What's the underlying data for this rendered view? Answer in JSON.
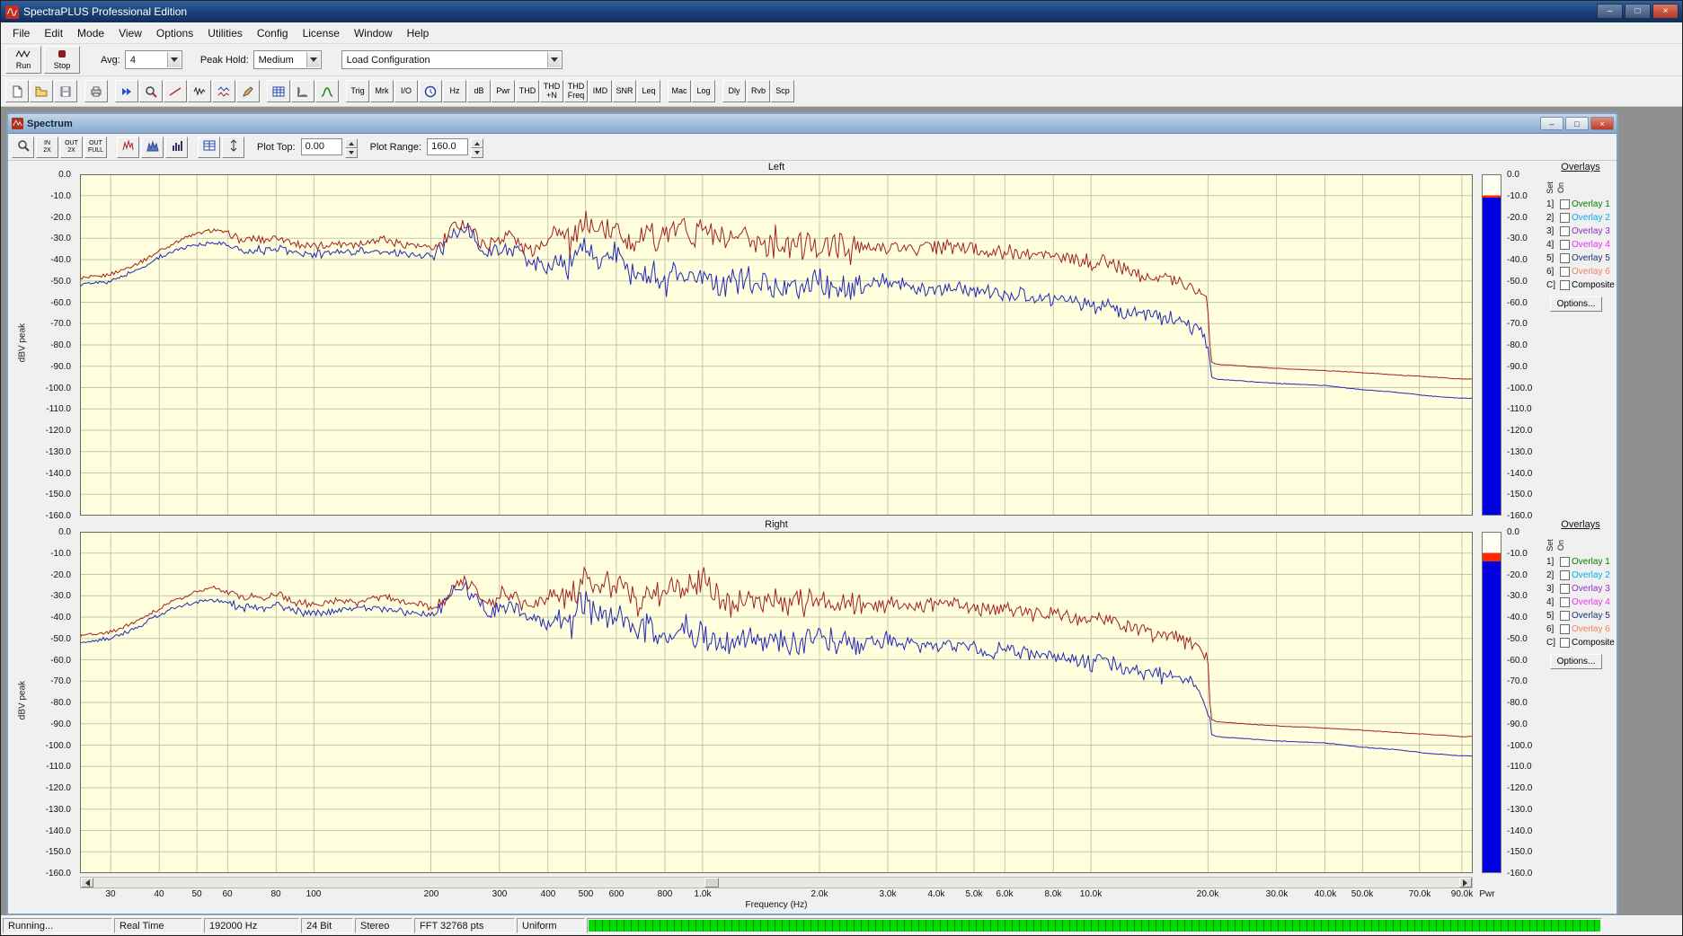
{
  "window": {
    "title": "SpectraPLUS Professional Edition"
  },
  "icons": {
    "minimize": "–",
    "maximize": "□",
    "close": "×"
  },
  "menu": {
    "items": [
      "File",
      "Edit",
      "Mode",
      "View",
      "Options",
      "Utilities",
      "Config",
      "License",
      "Window",
      "Help"
    ]
  },
  "transport": {
    "run": "Run",
    "stop": "Stop",
    "avg_label": "Avg:",
    "avg_value": "4",
    "peak_hold_label": "Peak Hold:",
    "peak_hold_value": "Medium",
    "config_value": "Load Configuration"
  },
  "toolbar": {
    "buttons": [
      {
        "type": "icon",
        "name": "new-document"
      },
      {
        "type": "icon",
        "name": "open-folder"
      },
      {
        "type": "icon",
        "name": "save"
      },
      {
        "type": "sep"
      },
      {
        "type": "icon",
        "name": "print"
      },
      {
        "type": "sep"
      },
      {
        "type": "icon",
        "name": "fast-forward"
      },
      {
        "type": "icon",
        "name": "zoom-wave"
      },
      {
        "type": "icon",
        "name": "slope"
      },
      {
        "type": "icon",
        "name": "waveform"
      },
      {
        "type": "icon",
        "name": "multi-waveform"
      },
      {
        "type": "icon",
        "name": "pen"
      },
      {
        "type": "sep"
      },
      {
        "type": "icon",
        "name": "data-grid"
      },
      {
        "type": "icon",
        "name": "ruler"
      },
      {
        "type": "icon",
        "name": "bell-curve"
      },
      {
        "type": "sep"
      },
      {
        "type": "text",
        "label": "Trig"
      },
      {
        "type": "text",
        "label": "Mrk"
      },
      {
        "type": "text",
        "label": "I/O"
      },
      {
        "type": "icon",
        "name": "clock"
      },
      {
        "type": "text",
        "label": "Hz"
      },
      {
        "type": "text",
        "label": "dB"
      },
      {
        "type": "text",
        "label": "Pwr"
      },
      {
        "type": "text",
        "label": "THD"
      },
      {
        "type": "text",
        "label": "THD\n+N"
      },
      {
        "type": "text",
        "label": "THD\nFreq"
      },
      {
        "type": "text",
        "label": "IMD"
      },
      {
        "type": "text",
        "label": "SNR"
      },
      {
        "type": "text",
        "label": "Leq"
      },
      {
        "type": "sep"
      },
      {
        "type": "text",
        "label": "Mac"
      },
      {
        "type": "text",
        "label": "Log"
      },
      {
        "type": "sep"
      },
      {
        "type": "text",
        "label": "Dly"
      },
      {
        "type": "text",
        "label": "Rvb"
      },
      {
        "type": "text",
        "label": "Scp"
      }
    ]
  },
  "spectrum": {
    "title": "Spectrum",
    "toolbar": {
      "buttons": [
        {
          "type": "icon",
          "name": "zoom-select"
        },
        {
          "type": "text",
          "label": "IN\n2X",
          "name": "zoom-in-2x"
        },
        {
          "type": "text",
          "label": "OUT\n2X",
          "name": "zoom-out-2x"
        },
        {
          "type": "text",
          "label": "OUT\nFULL",
          "name": "zoom-out-full"
        },
        {
          "type": "sep"
        },
        {
          "type": "icon",
          "name": "line-spectrum"
        },
        {
          "type": "icon",
          "name": "filled-spectrum"
        },
        {
          "type": "icon",
          "name": "bar-spectrum"
        },
        {
          "type": "sep"
        },
        {
          "type": "icon",
          "name": "table-display"
        },
        {
          "type": "icon",
          "name": "marker-line"
        }
      ],
      "plot_top_label": "Plot Top:",
      "plot_top_value": "0.00",
      "plot_range_label": "Plot Range:",
      "plot_range_value": "160.0"
    },
    "overlays": {
      "title": "Overlays",
      "set": "Set",
      "on": "On",
      "rows": [
        {
          "key": "1]",
          "label": "Overlay 1",
          "color": "#007F00"
        },
        {
          "key": "2]",
          "label": "Overlay 2",
          "color": "#00AEEF"
        },
        {
          "key": "3]",
          "label": "Overlay 3",
          "color": "#8B2FC9"
        },
        {
          "key": "4]",
          "label": "Overlay 4",
          "color": "#EE30EE"
        },
        {
          "key": "5]",
          "label": "Overlay 5",
          "color": "#1F2F6E"
        },
        {
          "key": "6]",
          "label": "Overlay 6",
          "color": "#F4845F"
        },
        {
          "key": "C]",
          "label": "Composite",
          "color": "#000000"
        }
      ],
      "options": "Options..."
    }
  },
  "status": {
    "segments": [
      "Running...",
      "Real Time",
      "192000 Hz",
      "24 Bit",
      "Stereo",
      "FFT 32768 pts",
      "Uniform"
    ]
  },
  "chart_data": {
    "type": "line",
    "xlabel": "Frequency (Hz)",
    "ylabel": "dBV peak",
    "xscale": "log",
    "xlim": [
      25,
      96000
    ],
    "ylim": [
      0,
      -160
    ],
    "grid": true,
    "pwr_label": "Pwr",
    "panels": [
      {
        "title": "Left",
        "peak_band_db": [
          -9.5,
          -10.5
        ]
      },
      {
        "title": "Right",
        "peak_band_db": [
          -9.5,
          -13.5
        ]
      }
    ],
    "y_ticks": [
      "0.0",
      "-10.0",
      "-20.0",
      "-30.0",
      "-40.0",
      "-50.0",
      "-60.0",
      "-70.0",
      "-80.0",
      "-90.0",
      "-100.0",
      "-110.0",
      "-120.0",
      "-130.0",
      "-140.0",
      "-150.0",
      "-160.0"
    ],
    "x_ticks": [
      {
        "label": "30",
        "f": 30
      },
      {
        "label": "40",
        "f": 40
      },
      {
        "label": "50",
        "f": 50
      },
      {
        "label": "60",
        "f": 60
      },
      {
        "label": "80",
        "f": 80
      },
      {
        "label": "100",
        "f": 100
      },
      {
        "label": "200",
        "f": 200
      },
      {
        "label": "300",
        "f": 300
      },
      {
        "label": "400",
        "f": 400
      },
      {
        "label": "500",
        "f": 500
      },
      {
        "label": "600",
        "f": 600
      },
      {
        "label": "800",
        "f": 800
      },
      {
        "label": "1.0k",
        "f": 1000
      },
      {
        "label": "2.0k",
        "f": 2000
      },
      {
        "label": "3.0k",
        "f": 3000
      },
      {
        "label": "4.0k",
        "f": 4000
      },
      {
        "label": "5.0k",
        "f": 5000
      },
      {
        "label": "6.0k",
        "f": 6000
      },
      {
        "label": "8.0k",
        "f": 8000
      },
      {
        "label": "10.0k",
        "f": 10000
      },
      {
        "label": "20.0k",
        "f": 20000
      },
      {
        "label": "30.0k",
        "f": 30000
      },
      {
        "label": "40.0k",
        "f": 40000
      },
      {
        "label": "50.0k",
        "f": 50000
      },
      {
        "label": "70.0k",
        "f": 70000
      },
      {
        "label": "90.0k",
        "f": 90000
      }
    ],
    "colors": {
      "plot_bg": "#FFFFDE",
      "grid": "#C6C6AE",
      "frame": "#6B6B5B",
      "trace_red": "#A22020",
      "trace_blue": "#2228B8",
      "colorbar_empty": "#FFFFF2",
      "colorbar_peak": "#FF2A00",
      "colorbar_body": "#0000E0"
    },
    "series": [
      {
        "name": "peak-hold-trace",
        "color": "#A22020",
        "points": [
          [
            25,
            -49
          ],
          [
            30,
            -47
          ],
          [
            35,
            -42
          ],
          [
            40,
            -36
          ],
          [
            45,
            -31
          ],
          [
            50,
            -28
          ],
          [
            55,
            -26
          ],
          [
            60,
            -28
          ],
          [
            65,
            -31
          ],
          [
            70,
            -30
          ],
          [
            75,
            -31
          ],
          [
            80,
            -29
          ],
          [
            90,
            -33
          ],
          [
            100,
            -34
          ],
          [
            110,
            -33
          ],
          [
            120,
            -32
          ],
          [
            130,
            -33
          ],
          [
            140,
            -31
          ],
          [
            150,
            -30
          ],
          [
            160,
            -32
          ],
          [
            180,
            -33
          ],
          [
            200,
            -35
          ],
          [
            215,
            -33
          ],
          [
            230,
            -24
          ],
          [
            245,
            -22
          ],
          [
            260,
            -28
          ],
          [
            280,
            -34
          ],
          [
            300,
            -30
          ],
          [
            320,
            -28
          ],
          [
            340,
            -33
          ],
          [
            360,
            -36
          ],
          [
            380,
            -33
          ],
          [
            400,
            -30
          ],
          [
            420,
            -26
          ],
          [
            440,
            -29
          ],
          [
            460,
            -32
          ],
          [
            480,
            -26
          ],
          [
            500,
            -21
          ],
          [
            520,
            -25
          ],
          [
            540,
            -28
          ],
          [
            560,
            -24
          ],
          [
            580,
            -27
          ],
          [
            600,
            -25
          ],
          [
            640,
            -30
          ],
          [
            680,
            -32
          ],
          [
            720,
            -29
          ],
          [
            760,
            -31
          ],
          [
            800,
            -28
          ],
          [
            850,
            -26
          ],
          [
            900,
            -24
          ],
          [
            950,
            -28
          ],
          [
            1000,
            -22
          ],
          [
            1100,
            -30
          ],
          [
            1200,
            -33
          ],
          [
            1300,
            -30
          ],
          [
            1400,
            -33
          ],
          [
            1500,
            -31
          ],
          [
            1700,
            -34
          ],
          [
            2000,
            -33
          ],
          [
            2300,
            -34
          ],
          [
            2600,
            -35
          ],
          [
            3000,
            -34
          ],
          [
            3500,
            -35
          ],
          [
            4000,
            -34
          ],
          [
            4500,
            -34
          ],
          [
            5000,
            -35
          ],
          [
            5500,
            -36
          ],
          [
            6000,
            -36
          ],
          [
            7000,
            -38
          ],
          [
            8000,
            -38
          ],
          [
            9000,
            -40
          ],
          [
            10000,
            -42
          ],
          [
            11000,
            -41
          ],
          [
            12000,
            -44
          ],
          [
            14000,
            -47
          ],
          [
            16000,
            -49
          ],
          [
            18000,
            -52
          ],
          [
            19000,
            -54
          ],
          [
            19700,
            -57
          ],
          [
            20000,
            -62
          ],
          [
            20400,
            -88
          ],
          [
            21000,
            -89
          ],
          [
            25000,
            -90
          ],
          [
            30000,
            -91
          ],
          [
            40000,
            -92
          ],
          [
            50000,
            -93
          ],
          [
            60000,
            -94
          ],
          [
            75000,
            -95
          ],
          [
            90000,
            -96
          ],
          [
            96000,
            -96
          ]
        ]
      },
      {
        "name": "average-trace",
        "color": "#2228B8",
        "points": [
          [
            25,
            -52
          ],
          [
            30,
            -50
          ],
          [
            35,
            -45
          ],
          [
            40,
            -39
          ],
          [
            45,
            -35
          ],
          [
            50,
            -33
          ],
          [
            55,
            -32
          ],
          [
            60,
            -33
          ],
          [
            65,
            -36
          ],
          [
            70,
            -35
          ],
          [
            75,
            -36
          ],
          [
            80,
            -34
          ],
          [
            90,
            -37
          ],
          [
            100,
            -38
          ],
          [
            110,
            -37
          ],
          [
            120,
            -36
          ],
          [
            140,
            -36
          ],
          [
            160,
            -37
          ],
          [
            180,
            -38
          ],
          [
            200,
            -39
          ],
          [
            215,
            -36
          ],
          [
            230,
            -27
          ],
          [
            245,
            -25
          ],
          [
            260,
            -31
          ],
          [
            280,
            -38
          ],
          [
            300,
            -36
          ],
          [
            320,
            -34
          ],
          [
            350,
            -40
          ],
          [
            380,
            -42
          ],
          [
            400,
            -44
          ],
          [
            430,
            -40
          ],
          [
            460,
            -45
          ],
          [
            480,
            -36
          ],
          [
            500,
            -31
          ],
          [
            520,
            -37
          ],
          [
            540,
            -42
          ],
          [
            560,
            -36
          ],
          [
            580,
            -41
          ],
          [
            600,
            -38
          ],
          [
            640,
            -45
          ],
          [
            680,
            -48
          ],
          [
            720,
            -45
          ],
          [
            760,
            -48
          ],
          [
            800,
            -51
          ],
          [
            850,
            -47
          ],
          [
            900,
            -44
          ],
          [
            950,
            -51
          ],
          [
            1000,
            -46
          ],
          [
            1100,
            -53
          ],
          [
            1200,
            -50
          ],
          [
            1300,
            -47
          ],
          [
            1400,
            -53
          ],
          [
            1500,
            -50
          ],
          [
            1700,
            -53
          ],
          [
            2000,
            -51
          ],
          [
            2300,
            -54
          ],
          [
            2600,
            -52
          ],
          [
            3000,
            -50
          ],
          [
            3500,
            -53
          ],
          [
            4000,
            -54
          ],
          [
            4500,
            -52
          ],
          [
            5000,
            -55
          ],
          [
            5500,
            -56
          ],
          [
            6000,
            -55
          ],
          [
            7000,
            -58
          ],
          [
            8000,
            -58
          ],
          [
            9000,
            -60
          ],
          [
            10000,
            -62
          ],
          [
            11000,
            -60
          ],
          [
            12000,
            -64
          ],
          [
            14000,
            -66
          ],
          [
            16000,
            -68
          ],
          [
            18000,
            -71
          ],
          [
            19000,
            -74
          ],
          [
            19700,
            -78
          ],
          [
            20000,
            -84
          ],
          [
            20400,
            -95
          ],
          [
            21000,
            -96
          ],
          [
            25000,
            -97
          ],
          [
            30000,
            -98
          ],
          [
            40000,
            -99
          ],
          [
            50000,
            -101
          ],
          [
            60000,
            -102
          ],
          [
            75000,
            -104
          ],
          [
            90000,
            -105
          ],
          [
            96000,
            -105
          ]
        ]
      }
    ]
  }
}
